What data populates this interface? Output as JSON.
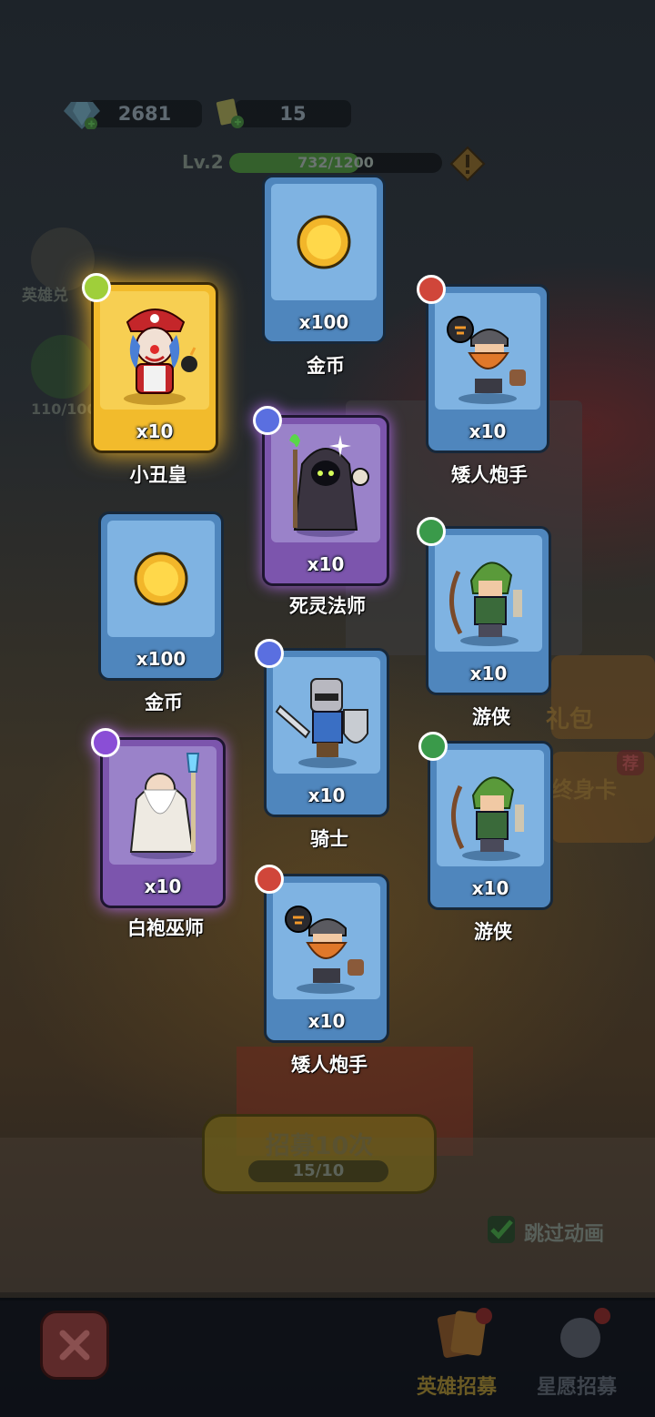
{
  "resources": {
    "gems": "2681",
    "tickets": "15"
  },
  "level": {
    "label": "Lv.2",
    "progress_text": "732/1200",
    "progress_fraction": 0.61
  },
  "side_menu": {
    "hero_exchange_label": "英雄兑",
    "stamina_value": "110/100"
  },
  "cards": [
    {
      "name": "小丑皇",
      "qty": "x10",
      "rarity": "legendary",
      "badge_icon": "skull-icon"
    },
    {
      "name": "金币",
      "qty": "x100",
      "rarity": "common",
      "badge_icon": ""
    },
    {
      "name": "矮人炮手",
      "qty": "x10",
      "rarity": "common",
      "badge_icon": "sword-icon"
    },
    {
      "name": "死灵法师",
      "qty": "x10",
      "rarity": "epic",
      "badge_icon": "swirl-icon"
    },
    {
      "name": "金币",
      "qty": "x100",
      "rarity": "common",
      "badge_icon": ""
    },
    {
      "name": "游侠",
      "qty": "x10",
      "rarity": "common",
      "badge_icon": "bow-icon"
    },
    {
      "name": "骑士",
      "qty": "x10",
      "rarity": "common",
      "badge_icon": "paw-icon"
    },
    {
      "name": "白袍巫师",
      "qty": "x10",
      "rarity": "epic",
      "badge_icon": "staff-icon"
    },
    {
      "name": "游侠",
      "qty": "x10",
      "rarity": "common",
      "badge_icon": "bow-icon"
    },
    {
      "name": "矮人炮手",
      "qty": "x10",
      "rarity": "common",
      "badge_icon": "sword-icon"
    }
  ],
  "recruit": {
    "button_label": "招募10次",
    "cost": "15/10",
    "skip_label": "跳过动画"
  },
  "side_offers": {
    "gift_label": "礼包",
    "card_label": "终身卡",
    "recommend_badge": "荐"
  },
  "tabs": {
    "hero_recruit": "英雄招募",
    "star_recruit": "星愿招募"
  },
  "colors": {
    "blue_card": "#4f86bd",
    "purple_card": "#7c55ad",
    "gold_card": "#f2bb2c",
    "badge_red": "#d0463a",
    "badge_green": "#3a9a4a",
    "badge_blue": "#5a6fe0",
    "badge_purple": "#8a4ed6",
    "badge_lime": "#9fcf3a"
  }
}
